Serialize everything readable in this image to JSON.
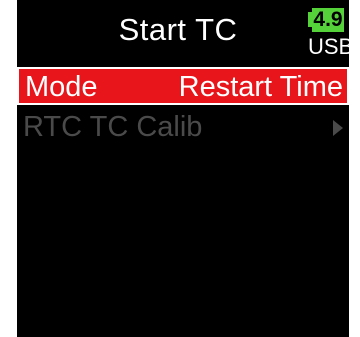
{
  "header": {
    "title": "Start TC",
    "battery_level": "4.9",
    "power_source": "USB"
  },
  "menu": {
    "items": [
      {
        "label": "Mode",
        "value": "Restart Time",
        "selected": true,
        "enabled": true
      },
      {
        "label": "RTC TC Calib",
        "value": "",
        "selected": false,
        "enabled": false,
        "icon": "chevron-right-icon"
      }
    ]
  },
  "colors": {
    "background": "#000000",
    "highlight": "#e8151b",
    "battery": "#55d23a",
    "disabled_text": "#4a4a4a",
    "text": "#ffffff"
  }
}
